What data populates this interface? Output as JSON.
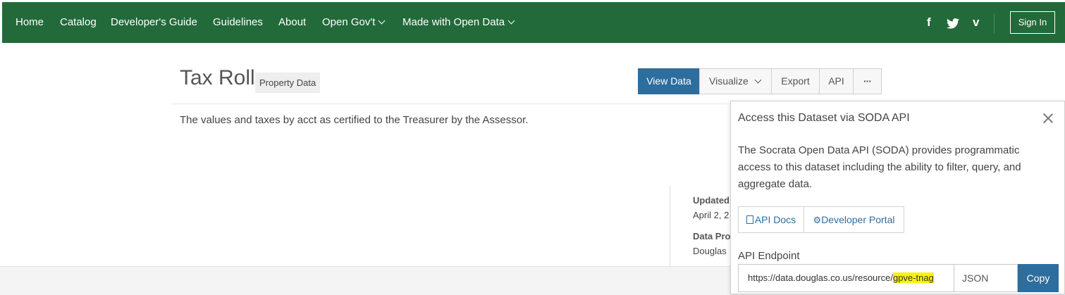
{
  "nav": {
    "items": [
      {
        "label": "Home",
        "dropdown": false
      },
      {
        "label": "Catalog",
        "dropdown": false
      },
      {
        "label": "Developer's Guide",
        "dropdown": false
      },
      {
        "label": "Guidelines",
        "dropdown": false
      },
      {
        "label": "About",
        "dropdown": false
      },
      {
        "label": "Open Gov't",
        "dropdown": true
      },
      {
        "label": "Made with Open Data",
        "dropdown": true
      }
    ],
    "social": {
      "facebook": "f",
      "twitter": "🐦",
      "vimeo": "v"
    },
    "sign_in": "Sign In",
    "bg_color": "#226a3a"
  },
  "dataset": {
    "title": "Tax Roll",
    "category_tag": "Property Data",
    "description": "The values and taxes by acct as certified to the Treasurer by the Assessor."
  },
  "actions": {
    "view_data": "View Data",
    "visualize": "Visualize",
    "export": "Export",
    "api": "API",
    "more": "···"
  },
  "meta": {
    "updated_label": "Updated",
    "updated_value": "April 2, 2",
    "provided_label": "Data Pro",
    "provided_value": "Douglas"
  },
  "api_panel": {
    "title": "Access this Dataset via SODA API",
    "description": "The Socrata Open Data API (SODA) provides programmatic access to this dataset including the ability to filter, query, and aggregate data.",
    "api_docs": "API Docs",
    "developer_portal": "Developer Portal",
    "endpoint_label": "API Endpoint",
    "endpoint_prefix": "https://data.douglas.co.us/resource/",
    "endpoint_id": "gpve-tnag",
    "format": "JSON",
    "copy": "Copy"
  }
}
